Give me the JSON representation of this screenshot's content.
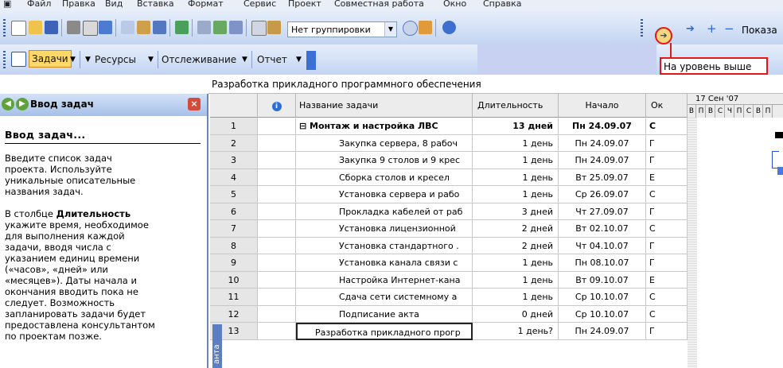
{
  "menu": [
    "Файл",
    "Правка",
    "Вид",
    "Вставка",
    "Формат",
    "Сервис",
    "Проект",
    "Совместная работа",
    "Окно",
    "Справка"
  ],
  "toolbar": {
    "grouping_value": "Нет группировки",
    "show_label": "Показа",
    "up_level_tooltip": "На уровень выше"
  },
  "project_guide": {
    "tasks_label": "Задачи",
    "resources_label": "Ресурсы",
    "tracking_label": "Отслеживание",
    "report_label": "Отчет"
  },
  "project_name": "Разработка прикладного программного обеспечения",
  "pane": {
    "title": "Ввод задач",
    "heading": "Ввод задач...",
    "para1": [
      "Введите список задач",
      "проекта. Используйте",
      "уникальные описательные",
      "названия задач."
    ],
    "para2_lead": "В столбце ",
    "para2_bold": "Длительность",
    "para2": [
      "укажите время, необходимое",
      "для выполнения каждой",
      "задачи, вводя числа с",
      "указанием единиц времени",
      "(«часов», «дней» или",
      "«месяцев»). Даты начала и",
      "окончания вводить пока не",
      "следует. Возможность",
      "запланировать задачи будет",
      "предоставлена консультантом",
      "по проектам позже."
    ],
    "side_tab": "анта"
  },
  "columns": {
    "info": "i",
    "name": "Название задачи",
    "duration": "Длительность",
    "start": "Начало",
    "finish": "Ок"
  },
  "gantt": {
    "week_label": "17 Сен '07",
    "days": [
      "В",
      "П",
      "В",
      "С",
      "Ч",
      "П",
      "С",
      "В",
      "П"
    ]
  },
  "tasks": [
    {
      "id": "1",
      "name": "Монтаж и настройка ЛВС",
      "duration": "13 дней",
      "start": "Пн 24.09.07",
      "finish": "С",
      "summary": true
    },
    {
      "id": "2",
      "name": "Закупка сервера, 8 рабоч",
      "duration": "1 день",
      "start": "Пн 24.09.07",
      "finish": "Г"
    },
    {
      "id": "3",
      "name": "Закупка 9 столов и 9 крес",
      "duration": "1 день",
      "start": "Пн 24.09.07",
      "finish": "Г"
    },
    {
      "id": "4",
      "name": "Сборка столов и кресел",
      "duration": "1 день",
      "start": "Вт 25.09.07",
      "finish": "Е"
    },
    {
      "id": "5",
      "name": "Установка сервера и рабо",
      "duration": "1 день",
      "start": "Ср 26.09.07",
      "finish": "С"
    },
    {
      "id": "6",
      "name": "Прокладка кабелей от раб",
      "duration": "3 дней",
      "start": "Чт 27.09.07",
      "finish": "Г"
    },
    {
      "id": "7",
      "name": "Установка лицензионной",
      "duration": "2 дней",
      "start": "Вт 02.10.07",
      "finish": "С"
    },
    {
      "id": "8",
      "name": "Установка стандартного .",
      "duration": "2 дней",
      "start": "Чт 04.10.07",
      "finish": "Г"
    },
    {
      "id": "9",
      "name": "Установка канала связи с",
      "duration": "1 день",
      "start": "Пн 08.10.07",
      "finish": "Г"
    },
    {
      "id": "10",
      "name": "Настройка Интернет-кана",
      "duration": "1 день",
      "start": "Вт 09.10.07",
      "finish": "Е"
    },
    {
      "id": "11",
      "name": "Сдача сети системному а",
      "duration": "1 день",
      "start": "Ср 10.10.07",
      "finish": "С"
    },
    {
      "id": "12",
      "name": "Подписание акта",
      "duration": "0 дней",
      "start": "Ср 10.10.07",
      "finish": "С"
    },
    {
      "id": "13",
      "name": "Разработка прикладного прогр",
      "duration": "1 день?",
      "start": "Пн 24.09.07",
      "finish": "Г",
      "selected": true
    }
  ]
}
